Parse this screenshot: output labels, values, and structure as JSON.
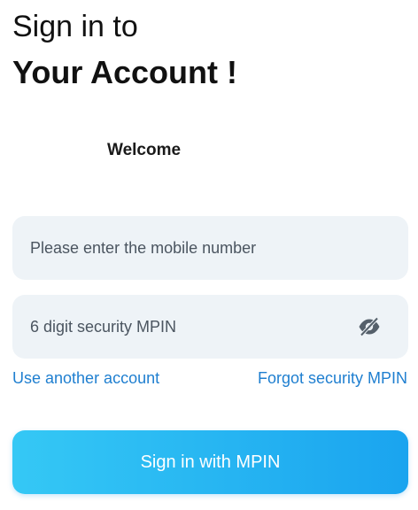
{
  "header": {
    "title_line1": "Sign in to",
    "title_line2": "Your Account !",
    "welcome": "Welcome"
  },
  "form": {
    "mobile": {
      "placeholder": "Please enter the mobile number",
      "value": ""
    },
    "mpin": {
      "placeholder": "6 digit security MPIN",
      "value": "",
      "toggle_icon": "eye-off-icon"
    }
  },
  "links": {
    "use_another_account": "Use another account",
    "forgot_mpin": "Forgot security MPIN"
  },
  "actions": {
    "signin_label": "Sign in with MPIN"
  },
  "colors": {
    "accent": "#1aa4ef",
    "accent_light": "#35c8f5",
    "link": "#1f7fd0",
    "field_bg": "#eef3f7"
  }
}
